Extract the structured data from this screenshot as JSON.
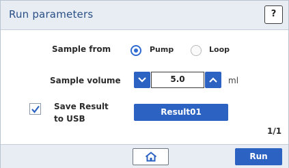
{
  "window": {
    "title": "Run parameters",
    "help_label": "?"
  },
  "sample_from": {
    "label": "Sample from",
    "options": [
      {
        "label": "Pump",
        "selected": true
      },
      {
        "label": "Loop",
        "selected": false
      }
    ]
  },
  "sample_volume": {
    "label": "Sample volume",
    "value": "5.0",
    "unit": "ml"
  },
  "save_result": {
    "label_line1": "Save Result",
    "label_line2": "to USB",
    "checked": true,
    "file_name": "Result01"
  },
  "pager": "1/1",
  "footer": {
    "run_label": "Run"
  },
  "colors": {
    "accent": "#2c62c2",
    "title_text": "#2a4f86",
    "bar_bg": "#e7edf3"
  },
  "icons": {
    "help": "question-mark",
    "decrease": "chevron-down-icon",
    "increase": "chevron-up-icon",
    "check": "check-icon",
    "home": "home-icon"
  }
}
